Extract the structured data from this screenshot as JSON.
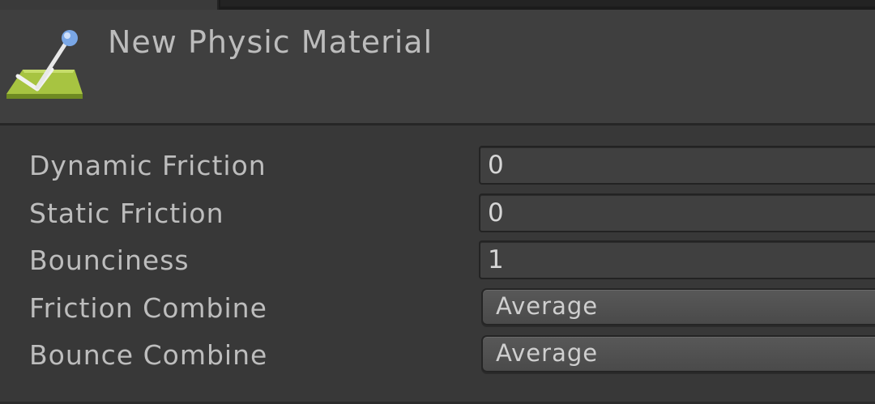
{
  "inspector": {
    "asset_title": "New Physic Material",
    "asset_icon": "physic-material-icon",
    "properties": [
      {
        "label": "Dynamic Friction",
        "value": "0",
        "kind": "float-field"
      },
      {
        "label": "Static Friction",
        "value": "0",
        "kind": "float-field"
      },
      {
        "label": "Bounciness",
        "value": "1",
        "kind": "float-field"
      },
      {
        "label": "Friction Combine",
        "value": "Average",
        "kind": "dropdown"
      },
      {
        "label": "Bounce Combine",
        "value": "Average",
        "kind": "dropdown"
      }
    ]
  },
  "colors": {
    "background": "#383838",
    "header": "#3f3f3f",
    "label_text": "#bdbdbd",
    "icon_green": "#9bbd3c",
    "icon_knob": "#6fa0e0"
  }
}
